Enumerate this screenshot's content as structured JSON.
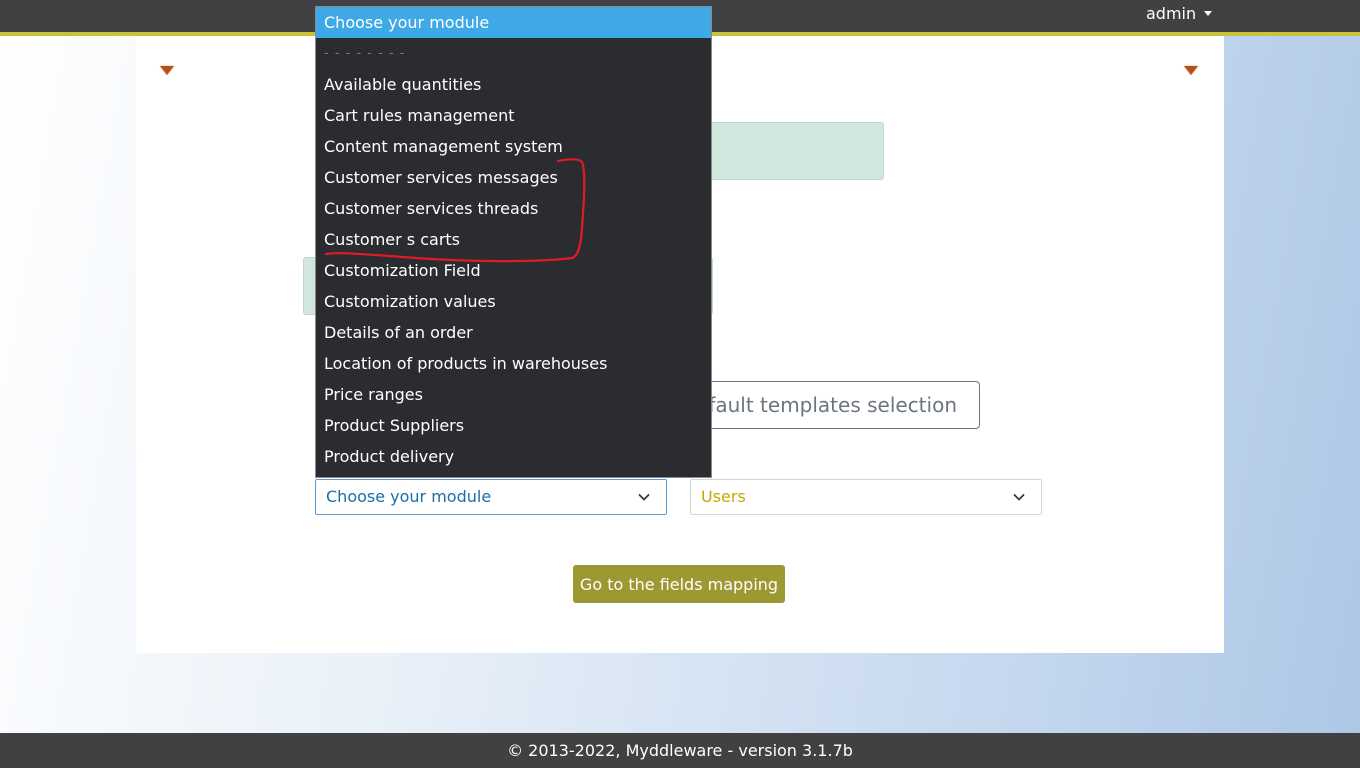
{
  "navbar": {
    "user_label": "admin"
  },
  "dropdown": {
    "options": [
      "Choose your module",
      "- - - - - - - -",
      "Available quantities",
      "Cart rules management",
      "Content management system",
      "Customer services messages",
      "Customer services threads",
      "Customer s carts",
      "Customization Field",
      "Customization values",
      "Details of an order",
      "Location of products in warehouses",
      "Price ranges",
      "Product Suppliers",
      "Product delivery"
    ]
  },
  "form": {
    "templates_button": "Default templates selection",
    "source_module_value": "Choose your module",
    "target_module_value": "Users",
    "go_button": "Go to the fields mapping"
  },
  "footer": {
    "text": "© 2013-2022, Myddleware - version 3.1.7b"
  },
  "colors": {
    "navbar_bg": "#414042",
    "accent": "#c9c23a",
    "selected_option": "#3fa9e8",
    "go_button": "#9c9832",
    "annotation": "#e01b24"
  }
}
